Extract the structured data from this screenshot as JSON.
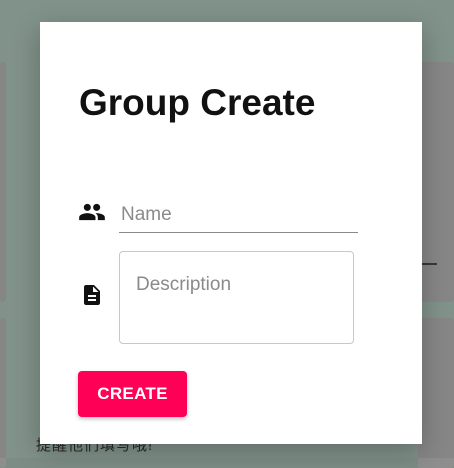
{
  "background": {
    "partial_text": "提醒他们填写哦!"
  },
  "dialog": {
    "title": "Group Create",
    "name_field": {
      "placeholder": "Name",
      "value": "",
      "icon": "group-icon"
    },
    "description_field": {
      "placeholder": "Description",
      "value": "",
      "icon": "document-icon"
    },
    "create_button_label": "CREATE"
  },
  "colors": {
    "accent": "#ff0057",
    "backdrop": "#889a92"
  }
}
